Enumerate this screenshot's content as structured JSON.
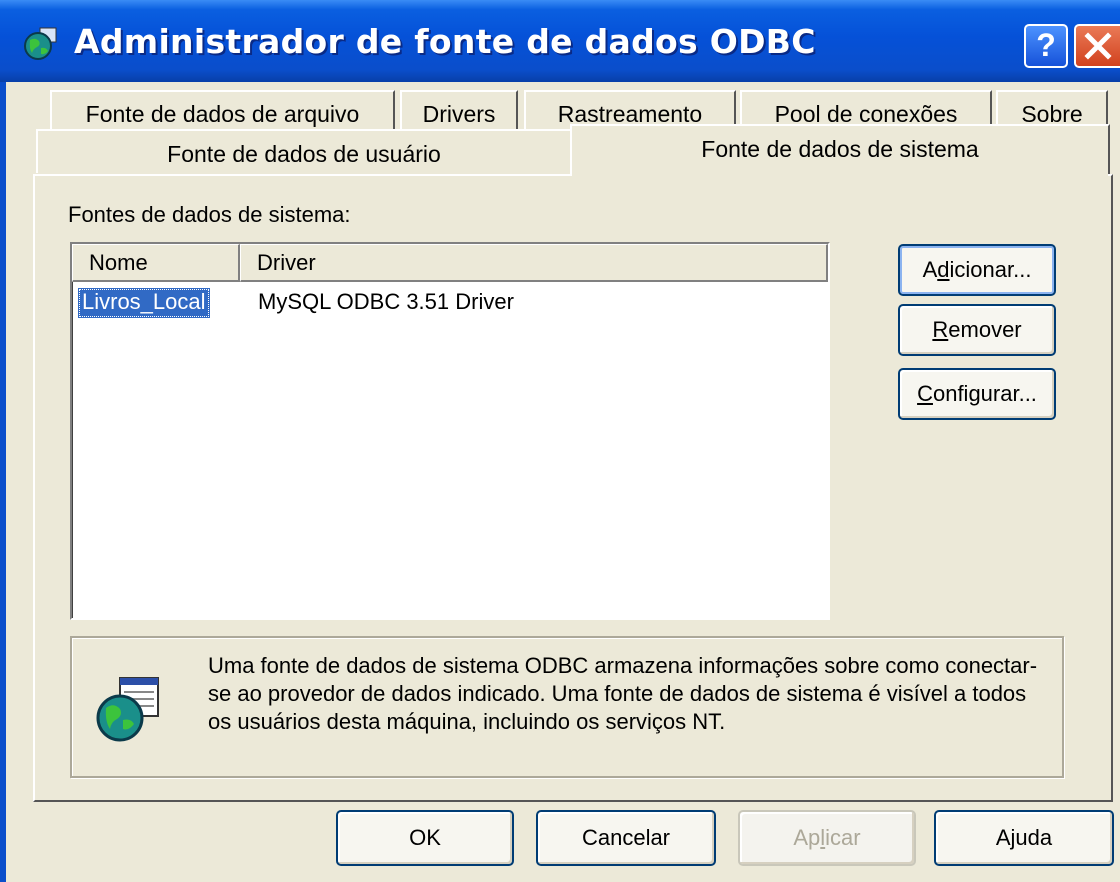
{
  "window": {
    "title": "Administrador de fonte de dados ODBC",
    "help_button": "?",
    "close_button": "X"
  },
  "tabs": {
    "row1": [
      "Fonte de dados de arquivo",
      "Drivers",
      "Rastreamento",
      "Pool de conexões",
      "Sobre"
    ],
    "row2_user": "Fonte de dados de usuário",
    "selected": "Fonte de dados de sistema"
  },
  "panel": {
    "list_label": "Fontes de dados de sistema:",
    "columns": {
      "name": "Nome",
      "driver": "Driver"
    },
    "rows": [
      {
        "name": "Livros_Local",
        "driver": "MySQL ODBC 3.51 Driver"
      }
    ],
    "buttons": {
      "add": "Adicionar...",
      "remove": "Remover",
      "configure": "Configurar..."
    },
    "info": "Uma fonte de dados de sistema ODBC armazena informações sobre como conectar-se ao provedor de dados indicado. Uma fonte de dados de sistema é visível a todos os usuários desta máquina, incluindo os serviços NT."
  },
  "footer": {
    "ok": "OK",
    "cancel": "Cancelar",
    "apply": "Aplicar",
    "help": "Ajuda"
  },
  "colors": {
    "titlebar": "#0551d8",
    "dialog_bg": "#ece9d8",
    "selection": "#316ac5",
    "button_border": "#003c74",
    "close_button": "#d1421e"
  },
  "icons": {
    "title": "odbc-globe-icon",
    "help": "help-icon",
    "close": "close-icon",
    "info": "data-source-globe-icon"
  }
}
